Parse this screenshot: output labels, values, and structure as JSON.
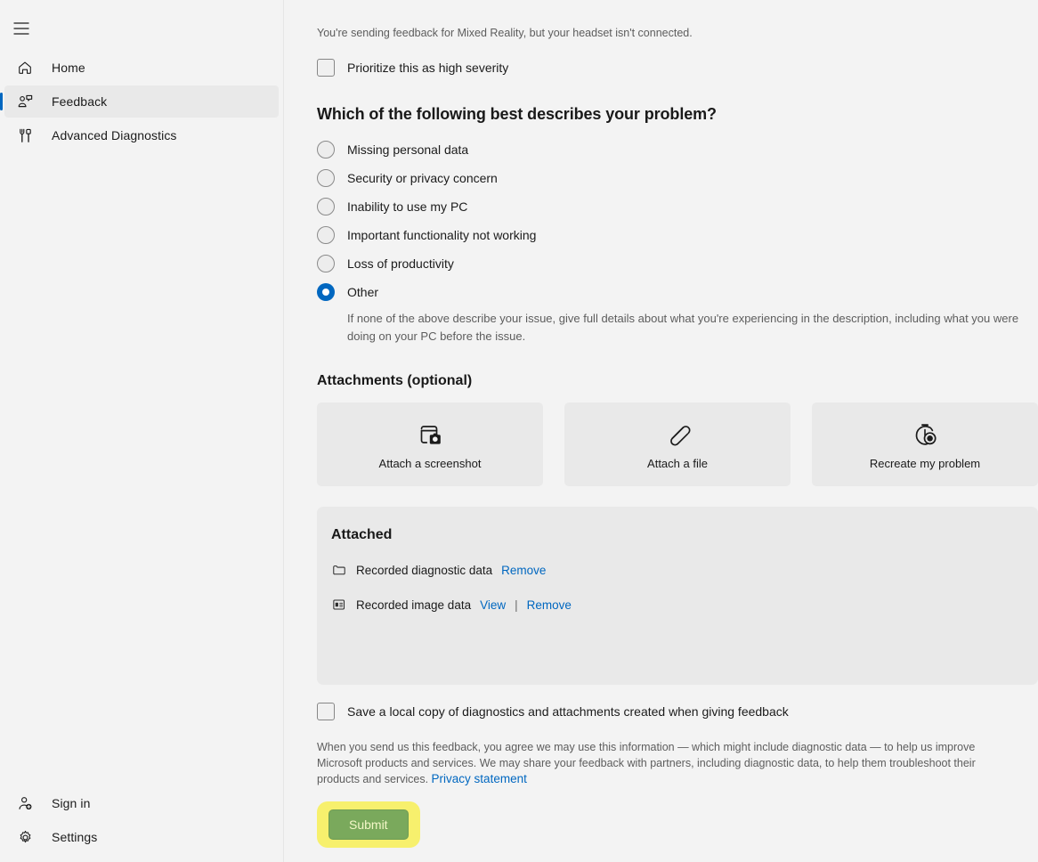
{
  "sidebar": {
    "menu_button": "menu-hamburger",
    "items": [
      {
        "label": "Home",
        "icon": "home-icon",
        "selected": false
      },
      {
        "label": "Feedback",
        "icon": "feedback-icon",
        "selected": true
      },
      {
        "label": "Advanced Diagnostics",
        "icon": "diagnostics-icon",
        "selected": false
      }
    ],
    "bottom_items": [
      {
        "label": "Sign in",
        "icon": "sign-in-icon"
      },
      {
        "label": "Settings",
        "icon": "gear-icon"
      }
    ]
  },
  "main": {
    "notice": "You're sending feedback for Mixed Reality, but your headset isn't connected.",
    "priority_checkbox": {
      "label": "Prioritize this as high severity",
      "checked": false
    },
    "problem_section": {
      "heading": "Which of the following best describes your problem?",
      "options": [
        {
          "label": "Missing personal data",
          "checked": false
        },
        {
          "label": "Security or privacy concern",
          "checked": false
        },
        {
          "label": "Inability to use my PC",
          "checked": false
        },
        {
          "label": "Important functionality not working",
          "checked": false
        },
        {
          "label": "Loss of productivity",
          "checked": false
        },
        {
          "label": "Other",
          "checked": true
        }
      ],
      "other_help": "If none of the above describe your issue, give full details about what you're experiencing in the description, including what you were doing on your PC before the issue."
    },
    "attachments": {
      "heading": "Attachments (optional)",
      "cards": [
        {
          "label": "Attach a screenshot",
          "icon": "screenshot-icon"
        },
        {
          "label": "Attach a file",
          "icon": "paperclip-icon"
        },
        {
          "label": "Recreate my problem",
          "icon": "stopwatch-record-icon"
        }
      ]
    },
    "attached": {
      "title": "Attached",
      "rows": [
        {
          "name": "Recorded diagnostic data",
          "icon": "folder-icon",
          "actions": [
            "Remove"
          ]
        },
        {
          "name": "Recorded image data",
          "icon": "image-data-icon",
          "actions": [
            "View",
            "Remove"
          ]
        }
      ],
      "separator": "|"
    },
    "save_copy_checkbox": {
      "label": "Save a local copy of diagnostics and attachments created when giving feedback",
      "checked": false
    },
    "legal": {
      "text": "When you send us this feedback, you agree we may use this information — which might include diagnostic data — to help us improve Microsoft products and services. We may share your feedback with partners, including diagnostic data, to help them troubleshoot their products and services. ",
      "link": "Privacy statement"
    },
    "submit": {
      "label": "Submit",
      "highlighted": true
    }
  },
  "colors": {
    "accent_blue": "#0067c0",
    "link_blue": "#0067c0",
    "page_bg": "#f3f3f3",
    "card_bg": "#e9e9e9",
    "submit_bg": "#7aa95c",
    "submit_highlight": "#f7f06d"
  }
}
